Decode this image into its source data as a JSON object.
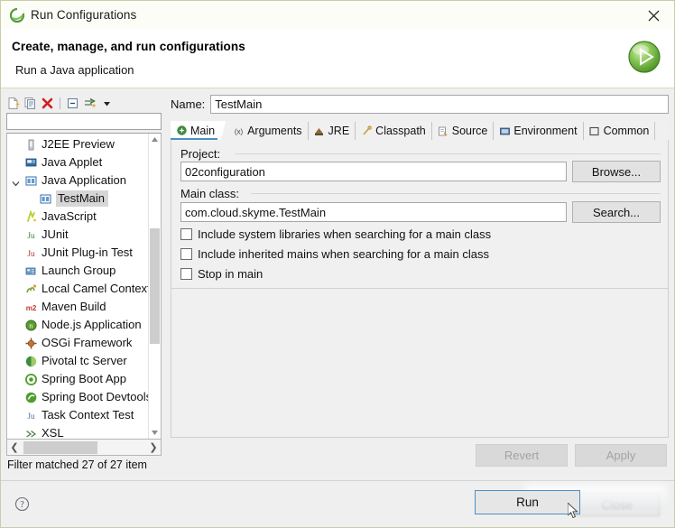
{
  "window": {
    "title": "Run Configurations",
    "app_icon": "eclipse-run-icon",
    "close_label": "close-icon"
  },
  "header": {
    "title": "Create, manage, and run configurations",
    "subtitle": "Run a Java application",
    "badge_icon": "run-green-play-icon"
  },
  "tree_toolbar": {
    "buttons": [
      {
        "name": "new-launch-configuration",
        "icon": "new-document-icon"
      },
      {
        "name": "duplicate-configuration",
        "icon": "duplicate-icon"
      },
      {
        "name": "delete-configuration",
        "icon": "delete-red-x-icon"
      },
      {
        "name": "collapse-all",
        "icon": "collapse-all-icon"
      },
      {
        "name": "filter-configurations",
        "icon": "filter-arrow-icon"
      },
      {
        "name": "view-menu",
        "icon": "chevron-down-icon"
      }
    ]
  },
  "filter": {
    "value": "",
    "placeholder": "",
    "status": "Filter matched 27 of 27 item"
  },
  "tree": {
    "items": [
      {
        "label": "J2EE Preview",
        "icon": "j2ee-preview-icon",
        "indent": 0,
        "selected": false,
        "twisty": "none"
      },
      {
        "label": "Java Applet",
        "icon": "java-applet-icon",
        "indent": 0,
        "selected": false,
        "twisty": "none"
      },
      {
        "label": "Java Application",
        "icon": "java-application-icon",
        "indent": 0,
        "selected": false,
        "twisty": "expanded"
      },
      {
        "label": "TestMain",
        "icon": "java-application-icon",
        "indent": 1,
        "selected": true,
        "twisty": "none"
      },
      {
        "label": "JavaScript",
        "icon": "javascript-icon",
        "indent": 0,
        "selected": false,
        "twisty": "none"
      },
      {
        "label": "JUnit",
        "icon": "junit-icon",
        "indent": 0,
        "selected": false,
        "twisty": "none"
      },
      {
        "label": "JUnit Plug-in Test",
        "icon": "junit-plugin-test-icon",
        "indent": 0,
        "selected": false,
        "twisty": "none"
      },
      {
        "label": "Launch Group",
        "icon": "launch-group-icon",
        "indent": 0,
        "selected": false,
        "twisty": "none"
      },
      {
        "label": "Local Camel Context",
        "icon": "camel-context-icon",
        "indent": 0,
        "selected": false,
        "twisty": "none"
      },
      {
        "label": "Maven Build",
        "icon": "maven-build-icon",
        "indent": 0,
        "selected": false,
        "twisty": "none"
      },
      {
        "label": "Node.js Application",
        "icon": "nodejs-icon",
        "indent": 0,
        "selected": false,
        "twisty": "none"
      },
      {
        "label": "OSGi Framework",
        "icon": "osgi-framework-icon",
        "indent": 0,
        "selected": false,
        "twisty": "none"
      },
      {
        "label": "Pivotal tc Server",
        "icon": "pivotal-tc-server-icon",
        "indent": 0,
        "selected": false,
        "twisty": "none"
      },
      {
        "label": "Spring Boot App",
        "icon": "spring-boot-icon",
        "indent": 0,
        "selected": false,
        "twisty": "none"
      },
      {
        "label": "Spring Boot Devtools",
        "icon": "spring-devtools-icon",
        "indent": 0,
        "selected": false,
        "twisty": "none"
      },
      {
        "label": "Task Context Test",
        "icon": "task-context-test-icon",
        "indent": 0,
        "selected": false,
        "twisty": "none"
      },
      {
        "label": "XSL",
        "icon": "xsl-icon",
        "indent": 0,
        "selected": false,
        "twisty": "none"
      }
    ]
  },
  "config": {
    "name_label": "Name:",
    "name_value": "TestMain"
  },
  "tabs": [
    {
      "label": "Main",
      "icon": "main-tab-icon",
      "active": true
    },
    {
      "label": "Arguments",
      "icon": "arguments-tab-icon",
      "active": false
    },
    {
      "label": "JRE",
      "icon": "jre-tab-icon",
      "active": false
    },
    {
      "label": "Classpath",
      "icon": "classpath-tab-icon",
      "active": false
    },
    {
      "label": "Source",
      "icon": "source-tab-icon",
      "active": false
    },
    {
      "label": "Environment",
      "icon": "environment-tab-icon",
      "active": false
    },
    {
      "label": "Common",
      "icon": "common-tab-icon",
      "active": false
    }
  ],
  "main_tab": {
    "project_label": "Project:",
    "project_value": "02configuration",
    "browse_label": "Browse...",
    "mainclass_label": "Main class:",
    "mainclass_value": "com.cloud.skyme.TestMain",
    "search_label": "Search...",
    "checkboxes": [
      {
        "label": "Include system libraries when searching for a main class",
        "checked": false
      },
      {
        "label": "Include inherited mains when searching for a main class",
        "checked": false
      },
      {
        "label": "Stop in main",
        "checked": false
      }
    ]
  },
  "actions": {
    "revert_label": "Revert",
    "revert_enabled": false,
    "apply_label": "Apply",
    "apply_enabled": false,
    "run_label": "Run",
    "close_label": "Close",
    "help_icon": "help-question-icon"
  },
  "colors": {
    "accent_blue": "#4a90c4",
    "window_border": "#c8cda8",
    "panel_bg": "#efefef",
    "tab_bg": "#f0f0f0",
    "selection": "#d6d6d6",
    "run_green": "#5aa832",
    "delete_red": "#cc2020"
  }
}
